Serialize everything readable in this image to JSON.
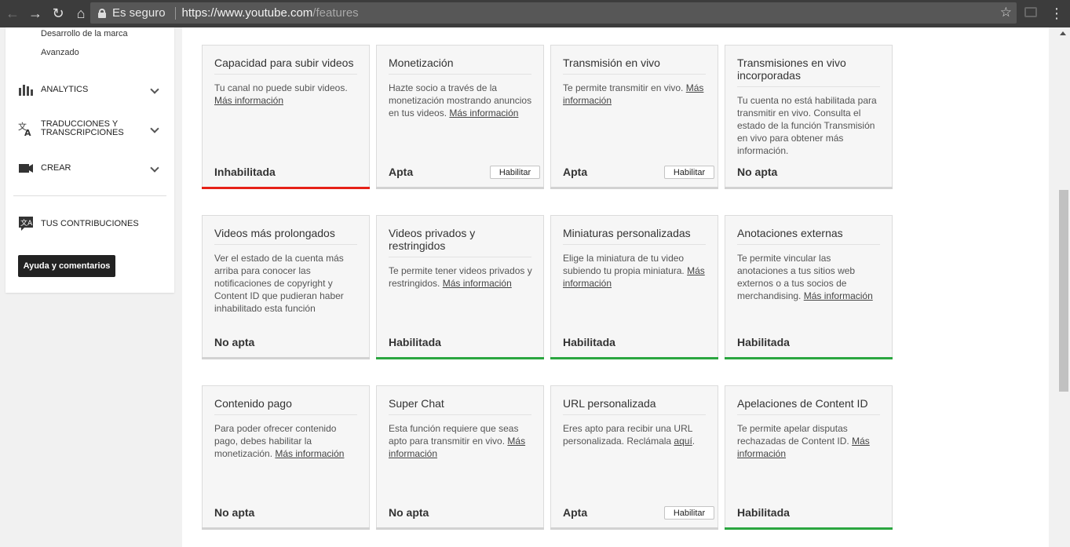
{
  "browser": {
    "secure_label": "Es seguro",
    "url_host": "https://www.youtube.com",
    "url_path": "/features"
  },
  "sidebar": {
    "sub_links": [
      "Desarrollo de la marca",
      "Avanzado"
    ],
    "items": [
      {
        "label": "ANALYTICS",
        "icon": "analytics-icon"
      },
      {
        "label_line1": "TRADUCCIONES Y",
        "label_line2": "TRANSCRIPCIONES",
        "icon": "translate-icon"
      },
      {
        "label": "CREAR",
        "icon": "video-camera-icon"
      },
      {
        "label": "TUS CONTRIBUCIONES",
        "icon": "contributions-icon"
      }
    ],
    "help_button": "Ayuda y comentarios"
  },
  "cards": [
    {
      "title": "Capacidad para subir videos",
      "desc": "Tu canal no puede subir videos.",
      "more": "Más información",
      "status": "Inhabilitada",
      "bar": "red"
    },
    {
      "title": "Monetización",
      "desc": "Hazte socio a través de la monetización mostrando anuncios en tus videos.",
      "more": "Más información",
      "status": "Apta",
      "button": "Habilitar",
      "bar": "grey"
    },
    {
      "title": "Transmisión en vivo",
      "desc": "Te permite transmitir en vivo.",
      "more": "Más información",
      "status": "Apta",
      "button": "Habilitar",
      "bar": "grey"
    },
    {
      "title": "Transmisiones en vivo incorporadas",
      "desc": "Tu cuenta no está habilitada para transmitir en vivo. Consulta el estado de la función Transmisión en vivo para obtener más información.",
      "status": "No apta",
      "bar": "grey"
    },
    {
      "title": "Videos más prolongados",
      "desc": "Ver el estado de la cuenta más arriba para conocer las notificaciones de copyright y Content ID que pudieran haber inhabilitado esta función",
      "status": "No apta",
      "bar": "grey"
    },
    {
      "title": "Videos privados y restringidos",
      "desc": "Te permite tener videos privados y restringidos.",
      "more": "Más información",
      "status": "Habilitada",
      "bar": "green"
    },
    {
      "title": "Miniaturas personalizadas",
      "desc": "Elige la miniatura de tu video subiendo tu propia miniatura.",
      "more": "Más información",
      "status": "Habilitada",
      "bar": "green"
    },
    {
      "title": "Anotaciones externas",
      "desc": "Te permite vincular las anotaciones a tus sitios web externos o a tus socios de merchandising.",
      "more": "Más información",
      "status": "Habilitada",
      "bar": "green"
    },
    {
      "title": "Contenido pago",
      "desc": "Para poder ofrecer contenido pago, debes habilitar la monetización.",
      "more": "Más información",
      "status": "No apta",
      "bar": "grey"
    },
    {
      "title": "Super Chat",
      "desc": "Esta función requiere que seas apto para transmitir en vivo.",
      "more": "Más información",
      "status": "No apta",
      "bar": "grey"
    },
    {
      "title": "URL personalizada",
      "desc": "Eres apto para recibir una URL personalizada. Reclámala",
      "more": "aquí",
      "after": ".",
      "status": "Apta",
      "button": "Habilitar",
      "bar": "grey"
    },
    {
      "title": "Apelaciones de Content ID",
      "desc": "Te permite apelar disputas rechazadas de Content ID.",
      "more": "Más información",
      "status": "Habilitada",
      "bar": "green"
    }
  ]
}
